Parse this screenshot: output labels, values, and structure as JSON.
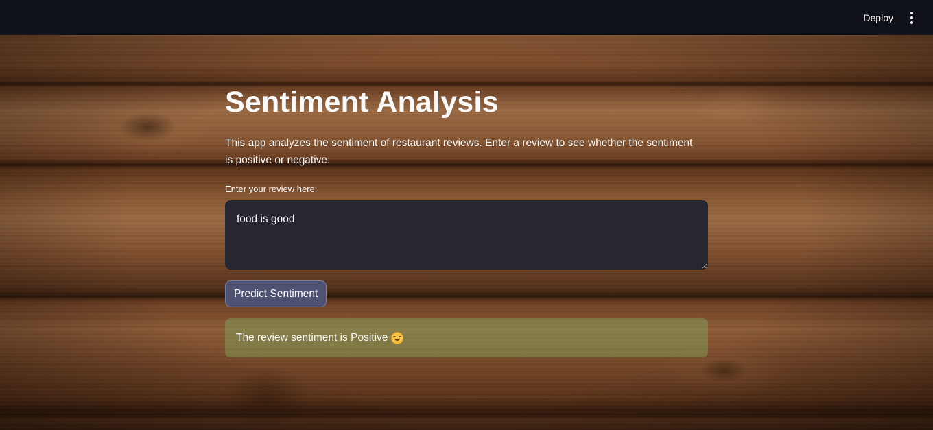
{
  "header": {
    "deploy_label": "Deploy",
    "menu_icon": "vertical-ellipsis-icon"
  },
  "main": {
    "title": "Sentiment Analysis",
    "description": "This app analyzes the sentiment of restaurant reviews. Enter a review to see whether the sentiment is positive or negative.",
    "input": {
      "label": "Enter your review here:",
      "value": "food is good"
    },
    "button": {
      "label": "Predict Sentiment"
    },
    "result": {
      "text": "The review sentiment is Positive",
      "icon": "smiling-face-emoji-icon"
    }
  },
  "colors": {
    "header_bg": "#0e1117",
    "textarea_bg": "#262730",
    "button_bg": "#4e5273",
    "success_bg": "#80a860"
  }
}
